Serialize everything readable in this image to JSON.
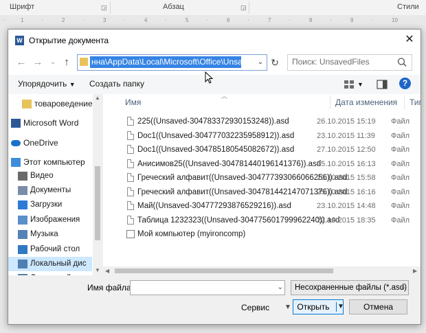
{
  "ribbon": {
    "groups": [
      "Шрифт",
      "Абзац",
      "Стили"
    ]
  },
  "dialog": {
    "title": "Открытие документа",
    "address": {
      "path": "нна\\AppData\\Local\\Microsoft\\Office\\UnsavedFiles"
    },
    "search": {
      "placeholder": "Поиск: UnsavedFiles"
    },
    "toolbar": {
      "organize": "Упорядочить",
      "new_folder": "Создать папку"
    },
    "nav_pane": {
      "items": [
        {
          "label": "товароведение",
          "icon": "folder-icon"
        },
        {
          "label": "Microsoft Word",
          "icon": "word-icon"
        },
        {
          "label": "OneDrive",
          "icon": "cloud-icon"
        },
        {
          "label": "Этот компьютер",
          "icon": "computer-icon"
        },
        {
          "label": "Видео",
          "icon": "video-icon"
        },
        {
          "label": "Документы",
          "icon": "documents-icon"
        },
        {
          "label": "Загрузки",
          "icon": "download-icon"
        },
        {
          "label": "Изображения",
          "icon": "pictures-icon"
        },
        {
          "label": "Музыка",
          "icon": "music-icon"
        },
        {
          "label": "Рабочий стол",
          "icon": "desktop-icon"
        },
        {
          "label": "Локальный дис",
          "icon": "disk-icon",
          "selected": true
        },
        {
          "label": "Локальный дис",
          "icon": "disk-icon"
        }
      ]
    },
    "file_list": {
      "columns": {
        "name": "Имя",
        "date": "Дата изменения",
        "type": "Тип"
      },
      "rows": [
        {
          "name": "225((Unsaved-304783372930153248)).asd",
          "date": "26.10.2015 15:19",
          "type": "Файл"
        },
        {
          "name": "Doc1((Unsaved-304777032235958912)).asd",
          "date": "23.10.2015 11:39",
          "type": "Файл"
        },
        {
          "name": "Doc1((Unsaved-304785180545082672)).asd",
          "date": "27.10.2015 12:50",
          "type": "Файл"
        },
        {
          "name": "Анисимов25((Unsaved-304781440196141376)).asd",
          "date": "25.10.2015 16:13",
          "type": "Файл"
        },
        {
          "name": "Греческий алфавит((Unsaved-304777393066066256)).asd",
          "date": "23.10.2015 15:58",
          "type": "Файл"
        },
        {
          "name": "Греческий алфавит((Unsaved-304781442147071376)).asd",
          "date": "25.10.2015 16:16",
          "type": "Файл"
        },
        {
          "name": "Май((Unsaved-304777293876529216)).asd",
          "date": "23.10.2015 14:48",
          "type": "Файл"
        },
        {
          "name": "Таблица 1232323((Unsaved-304775601799962240)).asd",
          "date": "22.10.2015 18:35",
          "type": "Файл"
        },
        {
          "name": "Мой компьютер (myironcomp)",
          "date": "",
          "type": ""
        }
      ]
    },
    "bottom": {
      "filename_label": "Имя файла:",
      "filename_value": "",
      "filetype": "Несохраненные файлы (*.asd)",
      "tools": "Сервис",
      "open": "Открыть",
      "cancel": "Отмена"
    }
  }
}
